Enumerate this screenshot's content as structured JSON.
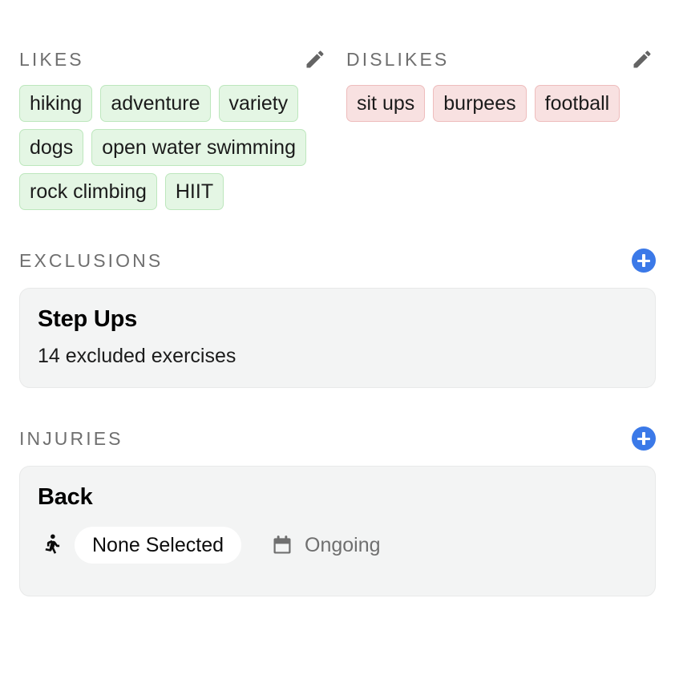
{
  "likes": {
    "title": "LIKES",
    "edit_icon": "pencil-icon",
    "chips": [
      "hiking",
      "adventure",
      "variety",
      "dogs",
      "open water swimming",
      "rock climbing",
      "HIIT"
    ]
  },
  "dislikes": {
    "title": "DISLIKES",
    "edit_icon": "pencil-icon",
    "chips": [
      "sit ups",
      "burpees",
      "football"
    ]
  },
  "exclusions": {
    "title": "EXCLUSIONS",
    "add_icon": "plus-icon",
    "card": {
      "title": "Step Ups",
      "subtitle": "14 excluded exercises"
    }
  },
  "injuries": {
    "title": "INJURIES",
    "add_icon": "plus-icon",
    "card": {
      "title": "Back",
      "status_icon": "walking-person-icon",
      "status": "None Selected",
      "date_icon": "calendar-icon",
      "date": "Ongoing"
    }
  },
  "colors": {
    "accent_blue": "#3b79e8",
    "like_chip_bg": "#e4f6e4",
    "like_chip_border": "#bde7bd",
    "dislike_chip_bg": "#f8e1e1",
    "dislike_chip_border": "#eebdbd",
    "card_bg": "#f3f4f4",
    "header_text": "#6f6f6f"
  }
}
